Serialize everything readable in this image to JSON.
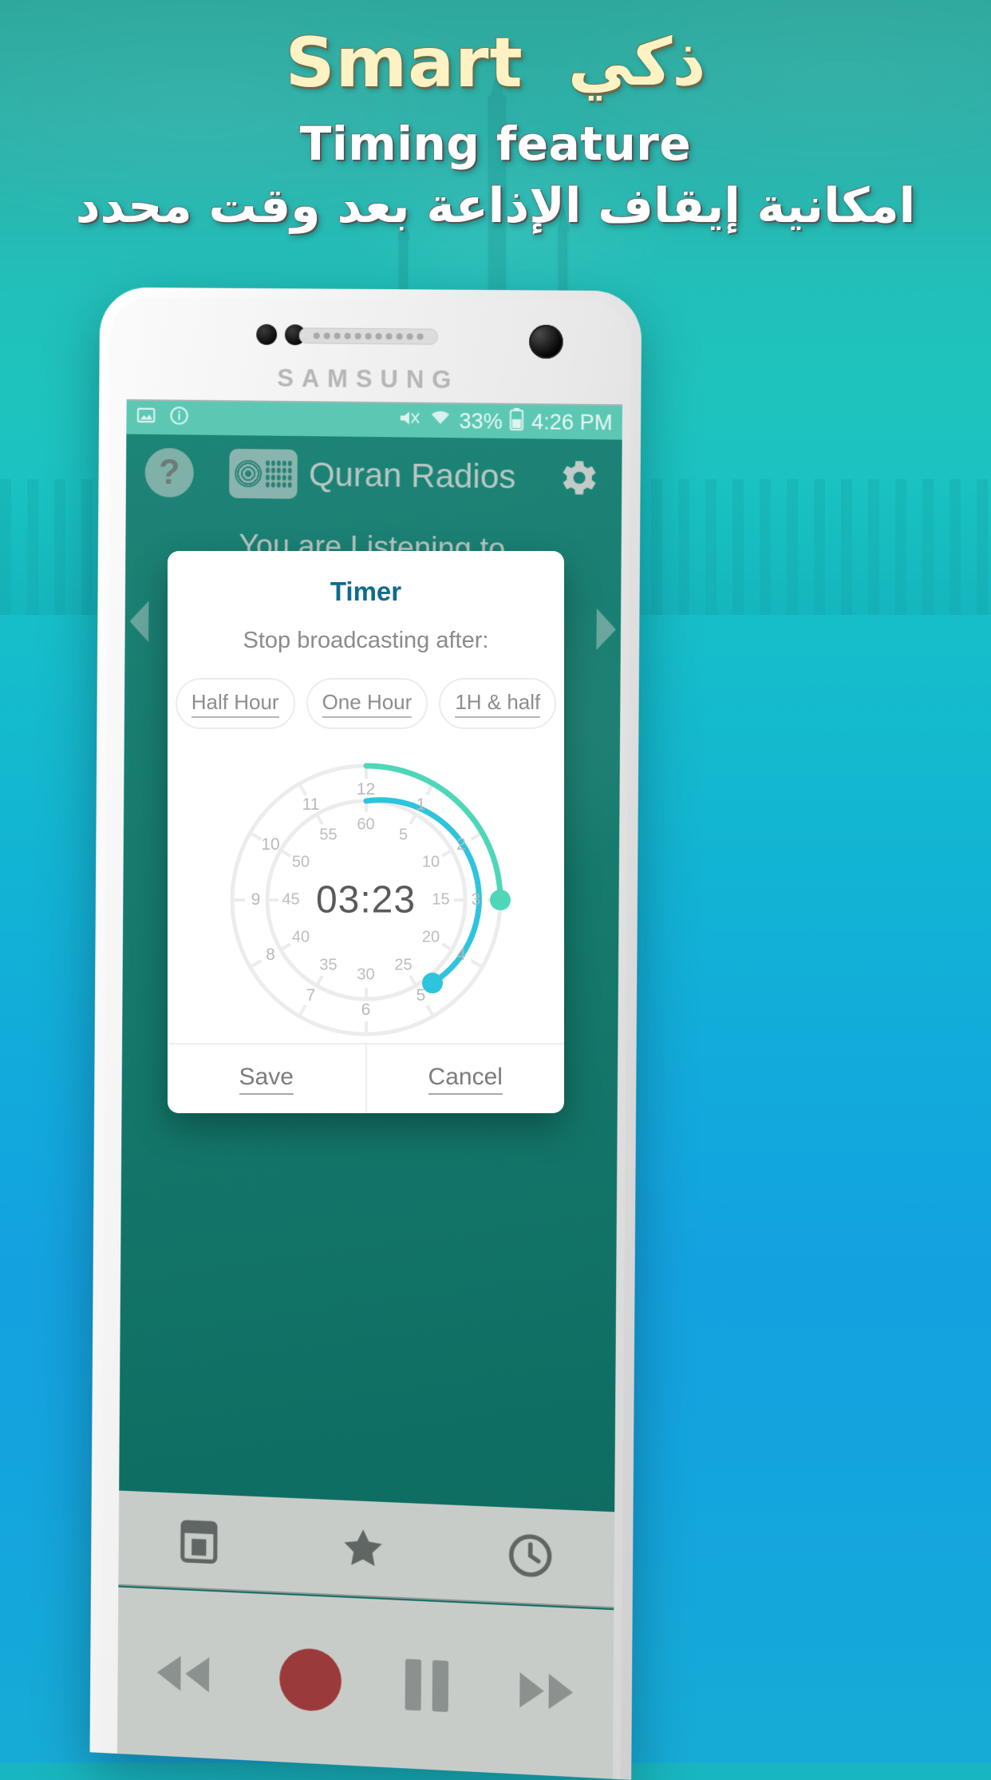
{
  "banner": {
    "hero_en": "Smart",
    "hero_ar": "ذكي",
    "sub_en": "Timing feature",
    "sub_ar": "امكانية إيقاف الإذاعة بعد وقت محدد"
  },
  "phone": {
    "brand": "SAMSUNG"
  },
  "statusbar": {
    "battery": "33%",
    "time": "4:26 PM",
    "icons": [
      "image-icon",
      "info-icon",
      "mute-icon",
      "wifi-icon",
      "battery-icon"
    ]
  },
  "app": {
    "title": "Quran Radios",
    "help_icon": "?",
    "gear_icon": "gear-icon",
    "radio_icon": "radio-icon",
    "listening_label": "You are Listening to"
  },
  "dialog": {
    "title": "Timer",
    "subtitle": "Stop broadcasting after:",
    "chips": [
      {
        "label": "Half Hour"
      },
      {
        "label": "One Hour"
      },
      {
        "label": "1H & half"
      }
    ],
    "clock": {
      "display": "03:23",
      "hours": [
        "12",
        "1",
        "2",
        "3",
        "4",
        "5",
        "6",
        "7",
        "8",
        "9",
        "10",
        "11"
      ],
      "minutes": [
        "60",
        "5",
        "10",
        "15",
        "20",
        "25",
        "30",
        "35",
        "40",
        "45",
        "50",
        "55"
      ],
      "selected_hour": 3,
      "selected_minute": 23,
      "hour_arc_color": "#4fd6b8",
      "minute_arc_color": "#2ec4de",
      "track_color": "#ececec"
    },
    "save_label": "Save",
    "cancel_label": "Cancel"
  },
  "bottom": {
    "tabs": [
      {
        "icon": "calendar-icon"
      },
      {
        "icon": "star-icon"
      },
      {
        "icon": "clock-icon"
      }
    ],
    "controls": [
      {
        "icon": "rewind-icon"
      },
      {
        "icon": "record-icon"
      },
      {
        "icon": "pause-icon"
      },
      {
        "icon": "forward-icon"
      }
    ]
  },
  "colors": {
    "banner_top": "#2fa89c",
    "banner_bottom": "#13a4de",
    "hero_text": "#fdf2c4",
    "dialog_title": "#0f6c8c",
    "statusbar_bg": "#5cc8b4",
    "app_bg": "#0f6e63"
  }
}
